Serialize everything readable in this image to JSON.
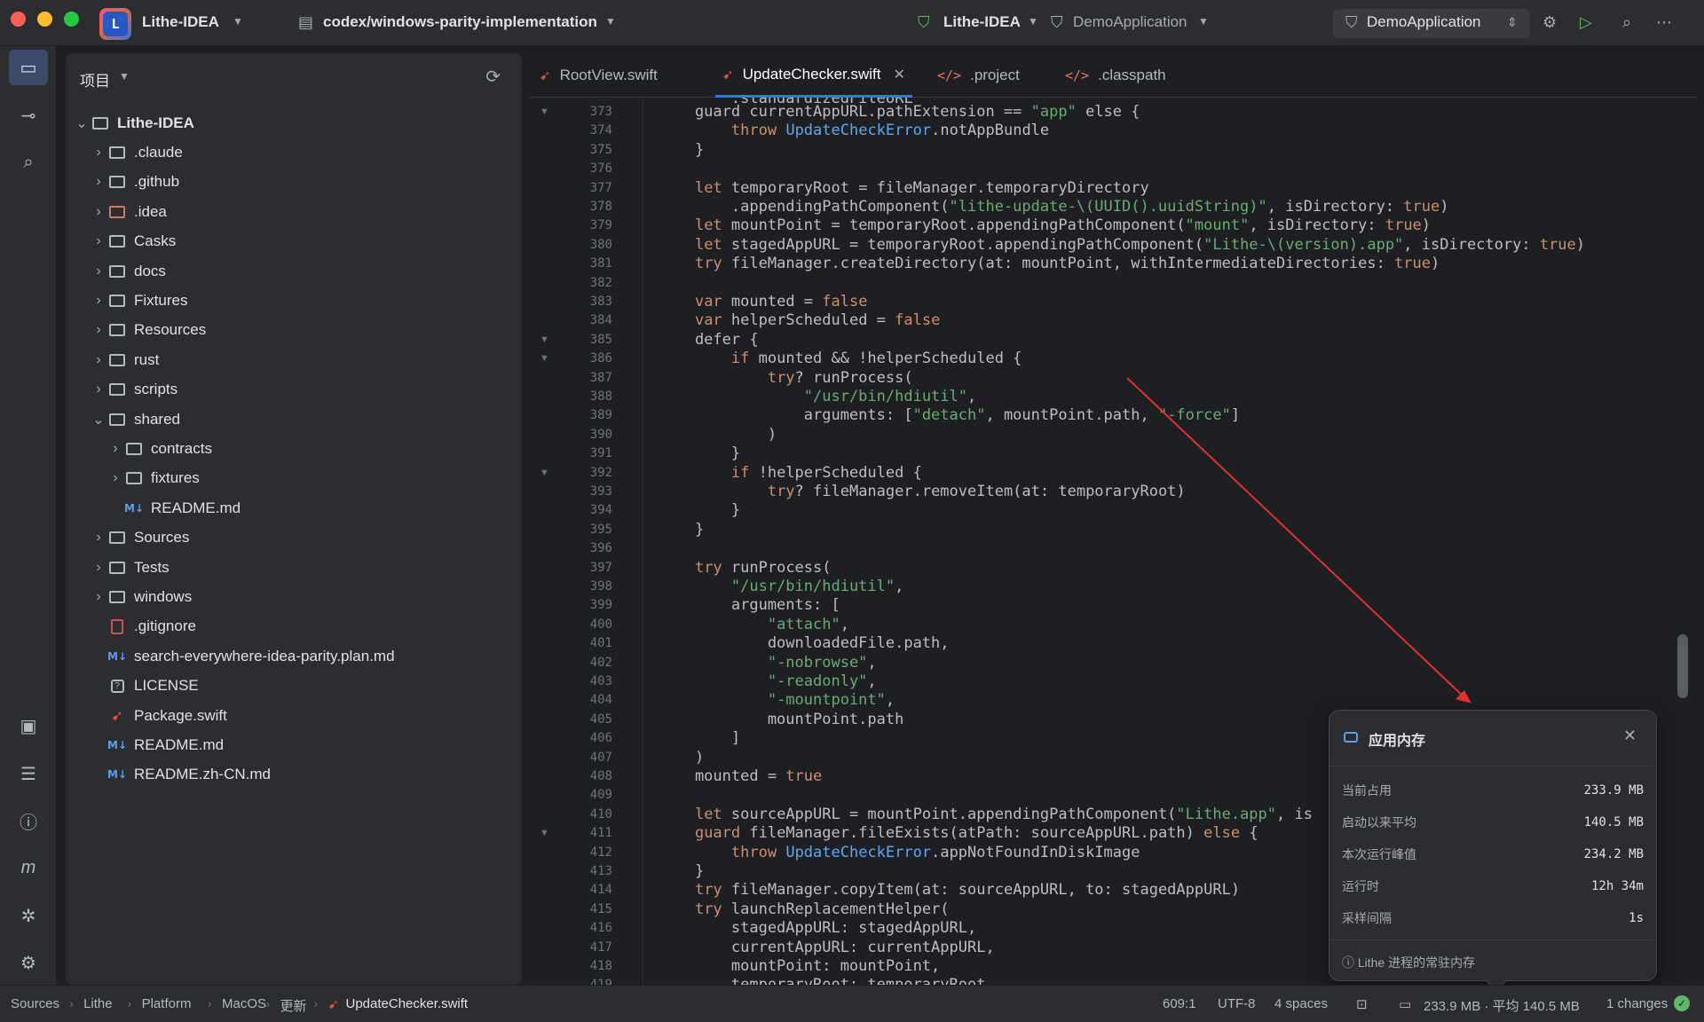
{
  "titlebar": {
    "project_name": "Lithe-IDEA",
    "branch": "codex/windows-parity-implementation",
    "vcs_project": "Lithe-IDEA",
    "vcs_config": "DemoApplication",
    "run_config": "DemoApplication"
  },
  "project_panel": {
    "title": "项目",
    "items": [
      {
        "label": "Lithe-IDEA",
        "kind": "folder",
        "depth": 0,
        "expanded": true,
        "bold": true
      },
      {
        "label": ".claude",
        "kind": "folder",
        "depth": 1
      },
      {
        "label": ".github",
        "kind": "folder",
        "depth": 1
      },
      {
        "label": ".idea",
        "kind": "folder-red",
        "depth": 1
      },
      {
        "label": "Casks",
        "kind": "folder",
        "depth": 1
      },
      {
        "label": "docs",
        "kind": "folder",
        "depth": 1
      },
      {
        "label": "Fixtures",
        "kind": "folder",
        "depth": 1
      },
      {
        "label": "Resources",
        "kind": "folder",
        "depth": 1
      },
      {
        "label": "rust",
        "kind": "folder",
        "depth": 1
      },
      {
        "label": "scripts",
        "kind": "folder",
        "depth": 1
      },
      {
        "label": "shared",
        "kind": "folder",
        "depth": 1,
        "expanded": true
      },
      {
        "label": "contracts",
        "kind": "folder",
        "depth": 2
      },
      {
        "label": "fixtures",
        "kind": "folder",
        "depth": 2
      },
      {
        "label": "README.md",
        "kind": "md",
        "depth": 2,
        "leaf": true
      },
      {
        "label": "Sources",
        "kind": "folder",
        "depth": 1
      },
      {
        "label": "Tests",
        "kind": "folder",
        "depth": 1
      },
      {
        "label": "windows",
        "kind": "folder",
        "depth": 1
      },
      {
        "label": ".gitignore",
        "kind": "gitignore",
        "depth": 1,
        "leaf": true
      },
      {
        "label": "search-everywhere-idea-parity.plan.md",
        "kind": "md",
        "depth": 1,
        "leaf": true
      },
      {
        "label": "LICENSE",
        "kind": "license",
        "depth": 1,
        "leaf": true
      },
      {
        "label": "Package.swift",
        "kind": "swift",
        "depth": 1,
        "leaf": true
      },
      {
        "label": "README.md",
        "kind": "md",
        "depth": 1,
        "leaf": true
      },
      {
        "label": "README.zh-CN.md",
        "kind": "md",
        "depth": 1,
        "leaf": true
      }
    ]
  },
  "editor": {
    "tabs": [
      {
        "label": "RootView.swift",
        "icon": "swift",
        "active": false
      },
      {
        "label": "UpdateChecker.swift",
        "icon": "swift",
        "active": true
      },
      {
        "label": ".project",
        "icon": "xml",
        "active": false
      },
      {
        "label": ".classpath",
        "icon": "xml",
        "active": false
      }
    ],
    "first_line": 373,
    "fold_lines": [
      373,
      385,
      386,
      392,
      411
    ],
    "lines": [
      [
        [
          "    guard currentAppURL.pathExtension == ",
          ""
        ],
        [
          "\"app\"",
          "str"
        ],
        [
          " else {",
          ""
        ]
      ],
      [
        [
          "        ",
          ""
        ],
        [
          "throw",
          "kw"
        ],
        [
          " ",
          ""
        ],
        [
          "UpdateCheckError",
          "ty"
        ],
        [
          ".notAppBundle",
          ""
        ]
      ],
      [
        [
          "    }",
          ""
        ]
      ],
      [
        [
          "",
          ""
        ]
      ],
      [
        [
          "    ",
          ""
        ],
        [
          "let",
          "kw"
        ],
        [
          " temporaryRoot = fileManager.temporaryDirectory",
          ""
        ]
      ],
      [
        [
          "        .appendingPathComponent(",
          ""
        ],
        [
          "\"lithe-update-\\(UUID().uuidString)\"",
          "str"
        ],
        [
          ", isDirectory: ",
          ""
        ],
        [
          "true",
          "kw"
        ],
        [
          ")",
          ""
        ]
      ],
      [
        [
          "    ",
          ""
        ],
        [
          "let",
          "kw"
        ],
        [
          " mountPoint = temporaryRoot.appendingPathComponent(",
          ""
        ],
        [
          "\"mount\"",
          "str"
        ],
        [
          ", isDirectory: ",
          ""
        ],
        [
          "true",
          "kw"
        ],
        [
          ")",
          ""
        ]
      ],
      [
        [
          "    ",
          ""
        ],
        [
          "let",
          "kw"
        ],
        [
          " stagedAppURL = temporaryRoot.appendingPathComponent(",
          ""
        ],
        [
          "\"Lithe-\\(version).app\"",
          "str"
        ],
        [
          ", isDirectory: ",
          ""
        ],
        [
          "true",
          "kw"
        ],
        [
          ")",
          ""
        ]
      ],
      [
        [
          "    ",
          ""
        ],
        [
          "try",
          "kw"
        ],
        [
          " fileManager.createDirectory(at: mountPoint, withIntermediateDirectories: ",
          ""
        ],
        [
          "true",
          "kw"
        ],
        [
          ")",
          ""
        ]
      ],
      [
        [
          "",
          ""
        ]
      ],
      [
        [
          "    ",
          ""
        ],
        [
          "var",
          "kw"
        ],
        [
          " mounted = ",
          ""
        ],
        [
          "false",
          "kw"
        ]
      ],
      [
        [
          "    ",
          ""
        ],
        [
          "var",
          "kw"
        ],
        [
          " helperScheduled = ",
          ""
        ],
        [
          "false",
          "kw"
        ]
      ],
      [
        [
          "    defer {",
          ""
        ]
      ],
      [
        [
          "        ",
          ""
        ],
        [
          "if",
          "kw"
        ],
        [
          " mounted && !helperScheduled {",
          ""
        ]
      ],
      [
        [
          "            ",
          ""
        ],
        [
          "try",
          "kw"
        ],
        [
          "? runProcess(",
          ""
        ]
      ],
      [
        [
          "                ",
          ""
        ],
        [
          "\"/usr/bin/hdiutil\"",
          "str"
        ],
        [
          ",",
          ""
        ]
      ],
      [
        [
          "                arguments: [",
          ""
        ],
        [
          "\"detach\"",
          "str"
        ],
        [
          ", mountPoint.path, ",
          ""
        ],
        [
          "\"-force\"",
          "str"
        ],
        [
          "]",
          ""
        ]
      ],
      [
        [
          "            )",
          ""
        ]
      ],
      [
        [
          "        }",
          ""
        ]
      ],
      [
        [
          "        ",
          ""
        ],
        [
          "if",
          "kw"
        ],
        [
          " !helperScheduled {",
          ""
        ]
      ],
      [
        [
          "            ",
          ""
        ],
        [
          "try",
          "kw"
        ],
        [
          "? fileManager.removeItem(at: temporaryRoot)",
          ""
        ]
      ],
      [
        [
          "        }",
          ""
        ]
      ],
      [
        [
          "    }",
          ""
        ]
      ],
      [
        [
          "",
          ""
        ]
      ],
      [
        [
          "    ",
          ""
        ],
        [
          "try",
          "kw"
        ],
        [
          " runProcess(",
          ""
        ]
      ],
      [
        [
          "        ",
          ""
        ],
        [
          "\"/usr/bin/hdiutil\"",
          "str"
        ],
        [
          ",",
          ""
        ]
      ],
      [
        [
          "        arguments: [",
          ""
        ]
      ],
      [
        [
          "            ",
          ""
        ],
        [
          "\"attach\"",
          "str"
        ],
        [
          ",",
          ""
        ]
      ],
      [
        [
          "            downloadedFile.path,",
          ""
        ]
      ],
      [
        [
          "            ",
          ""
        ],
        [
          "\"-nobrowse\"",
          "str"
        ],
        [
          ",",
          ""
        ]
      ],
      [
        [
          "            ",
          ""
        ],
        [
          "\"-readonly\"",
          "str"
        ],
        [
          ",",
          ""
        ]
      ],
      [
        [
          "            ",
          ""
        ],
        [
          "\"-mountpoint\"",
          "str"
        ],
        [
          ",",
          ""
        ]
      ],
      [
        [
          "            mountPoint.path",
          ""
        ]
      ],
      [
        [
          "        ]",
          ""
        ]
      ],
      [
        [
          "    )",
          ""
        ]
      ],
      [
        [
          "    mounted = ",
          ""
        ],
        [
          "true",
          "kw"
        ]
      ],
      [
        [
          "",
          ""
        ]
      ],
      [
        [
          "    ",
          ""
        ],
        [
          "let",
          "kw"
        ],
        [
          " sourceAppURL = mountPoint.appendingPathComponent(",
          ""
        ],
        [
          "\"Lithe.app\"",
          "str"
        ],
        [
          ", is",
          ""
        ]
      ],
      [
        [
          "    ",
          ""
        ],
        [
          "guard",
          "kw"
        ],
        [
          " fileManager.fileExists(atPath: sourceAppURL.path) ",
          ""
        ],
        [
          "else",
          "kw"
        ],
        [
          " {",
          ""
        ]
      ],
      [
        [
          "        ",
          ""
        ],
        [
          "throw",
          "kw"
        ],
        [
          " ",
          ""
        ],
        [
          "UpdateCheckError",
          "ty"
        ],
        [
          ".appNotFoundInDiskImage",
          ""
        ]
      ],
      [
        [
          "    }",
          ""
        ]
      ],
      [
        [
          "    ",
          ""
        ],
        [
          "try",
          "kw"
        ],
        [
          " fileManager.copyItem(at: sourceAppURL, to: stagedAppURL)",
          ""
        ]
      ],
      [
        [
          "    ",
          ""
        ],
        [
          "try",
          "kw"
        ],
        [
          " launchReplacementHelper(",
          ""
        ]
      ],
      [
        [
          "        stagedAppURL: stagedAppURL,",
          ""
        ]
      ],
      [
        [
          "        currentAppURL: currentAppURL,",
          ""
        ]
      ],
      [
        [
          "        mountPoint: mountPoint,",
          ""
        ]
      ],
      [
        [
          "        temporaryRoot: temporaryRoot",
          ""
        ]
      ]
    ]
  },
  "memory_popup": {
    "title": "应用内存",
    "rows": [
      {
        "label": "当前占用",
        "value": "233.9 MB"
      },
      {
        "label": "启动以来平均",
        "value": "140.5 MB"
      },
      {
        "label": "本次运行峰值",
        "value": "234.2 MB"
      },
      {
        "label": "运行时",
        "value": "12h 34m"
      },
      {
        "label": "采样间隔",
        "value": "1s"
      }
    ],
    "footer": "Lithe 进程的常驻内存"
  },
  "statusbar": {
    "breadcrumbs": [
      "Sources",
      "Lithe",
      "Platform",
      "MacOS",
      "更新",
      "UpdateChecker.swift"
    ],
    "position": "609:1",
    "encoding": "UTF-8",
    "indent": "4 spaces",
    "memory": "233.9 MB · 平均 140.5 MB",
    "changes": "1 changes"
  },
  "colors": {
    "accent": "#3574f0",
    "keyword": "#cf8e6d",
    "string": "#6aab73",
    "type": "#5fa8f0",
    "annotation_arrow": "#e03030"
  },
  "icons": [
    "folder-icon",
    "vcs-icon",
    "search-icon",
    "terminal-icon",
    "problems-icon",
    "structure-icon",
    "debug-icon",
    "settings-icon",
    "run-icon",
    "more-icon",
    "refresh-icon",
    "close-icon",
    "memory-icon",
    "info-icon",
    "check-icon"
  ]
}
